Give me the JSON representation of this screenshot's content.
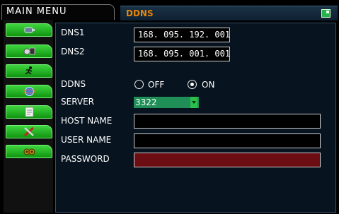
{
  "header": {
    "main_menu": "MAIN MENU",
    "title": "DDNS",
    "corner_icon": "window-toggle-icon"
  },
  "sidebar": {
    "items": [
      {
        "icon": "camera-icon"
      },
      {
        "icon": "film-record-icon"
      },
      {
        "icon": "running-man-icon"
      },
      {
        "icon": "network-globe-icon"
      },
      {
        "icon": "document-icon"
      },
      {
        "icon": "tools-icon"
      },
      {
        "icon": "speaker-icon"
      }
    ]
  },
  "form": {
    "dns1_label": "DNS1",
    "dns1_value": "168. 095. 192. 001",
    "dns2_label": "DNS2",
    "dns2_value": "168. 095. 001. 001",
    "ddns_label": "DDNS",
    "ddns_off": "OFF",
    "ddns_on": "ON",
    "ddns_selected": "ON",
    "server_label": "SERVER",
    "server_value": "3322",
    "host_label": "HOST NAME",
    "host_value": "",
    "user_label": "USER NAME",
    "user_value": "",
    "password_label": "PASSWORD",
    "password_value": ""
  },
  "colors": {
    "title": "#e6840a",
    "nav_button": "#2bbf2b",
    "server_select": "#1f8f57",
    "password_field": "#6b0d12"
  }
}
